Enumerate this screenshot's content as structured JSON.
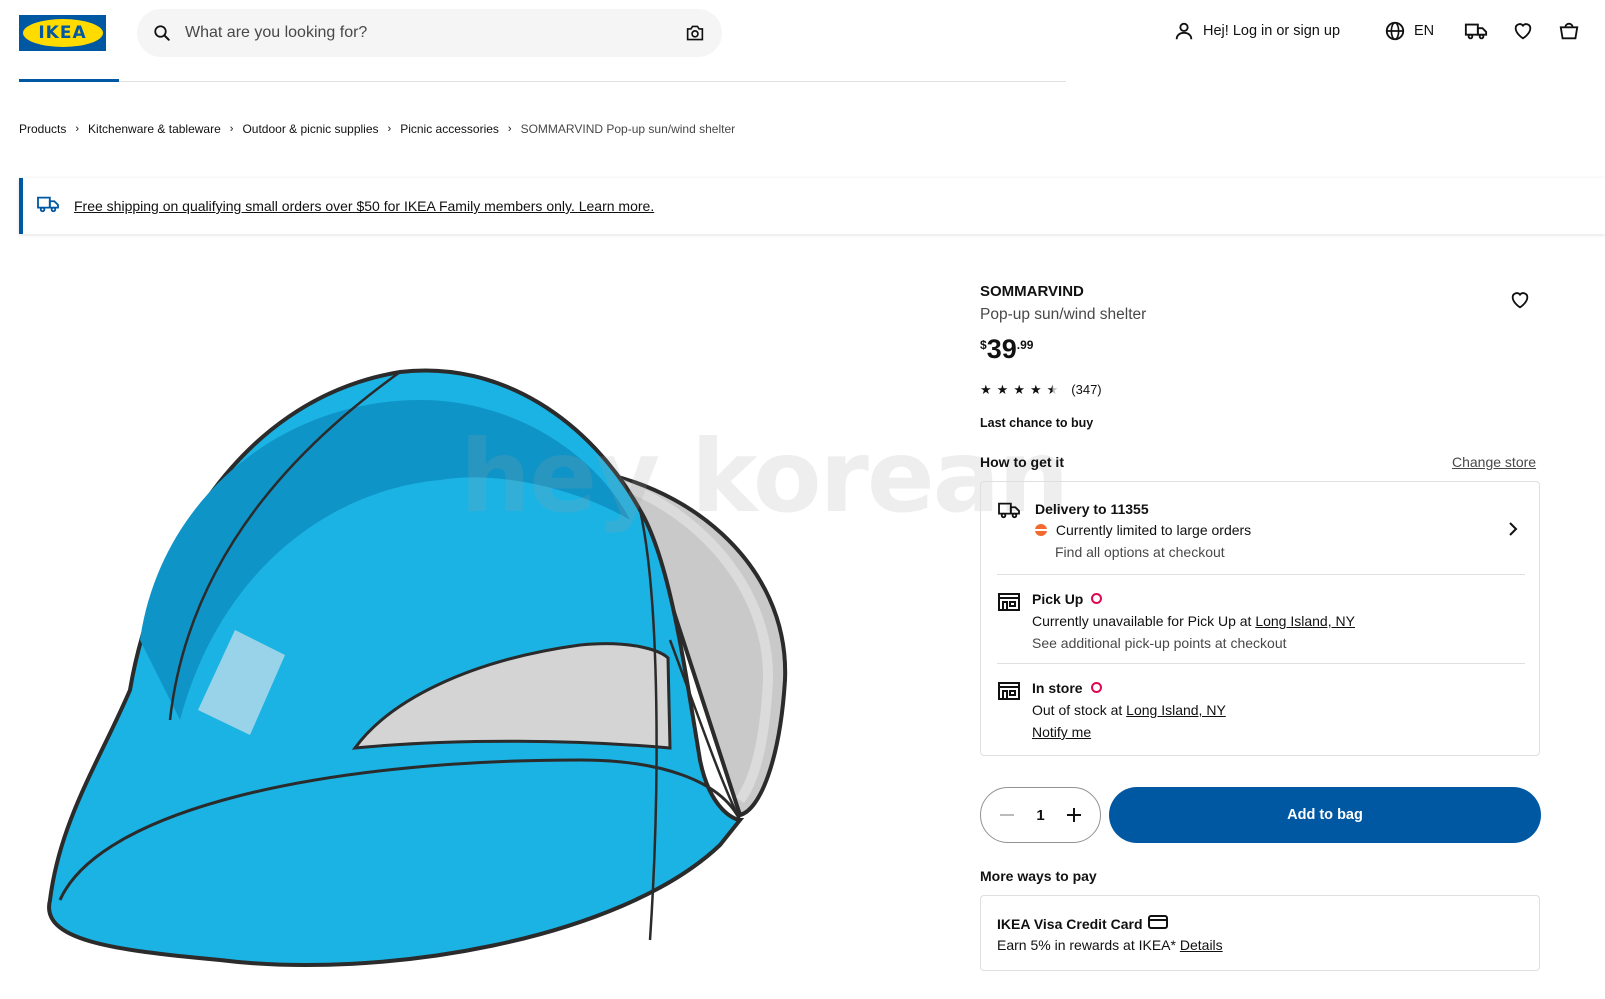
{
  "header": {
    "logo_text": "IKEA",
    "search_placeholder": "What are you looking for?",
    "login_label": "Hej! Log in or sign up",
    "language": "EN"
  },
  "breadcrumb": {
    "items": [
      "Products",
      "Kitchenware & tableware",
      "Outdoor & picnic supplies",
      "Picnic accessories"
    ],
    "current": "SOMMARVIND Pop-up sun/wind shelter"
  },
  "banner": {
    "text": "Free shipping on qualifying small orders over $50 for IKEA Family members only. Learn more."
  },
  "product": {
    "name": "SOMMARVIND",
    "description": "Pop-up sun/wind shelter",
    "price_currency": "$",
    "price_integer": "39",
    "price_decimal": ".99",
    "rating": 4.5,
    "review_count": "(347)",
    "status": "Last chance to buy",
    "watermark": "hey korean"
  },
  "availability": {
    "title": "How to get it",
    "change_store": "Change store",
    "delivery": {
      "title": "Delivery to 11355",
      "line": "Currently limited to large orders",
      "sub": "Find all options at checkout"
    },
    "pickup": {
      "title": "Pick Up",
      "line_prefix": "Currently unavailable for Pick Up at ",
      "store": "Long Island, NY",
      "sub": "See additional pick-up points at checkout"
    },
    "instore": {
      "title": "In store",
      "line_prefix": "Out of stock at ",
      "store": "Long Island, NY",
      "notify": "Notify me"
    }
  },
  "purchase": {
    "quantity": "1",
    "add_to_bag": "Add to bag"
  },
  "payment": {
    "title": "More ways to pay",
    "card_title": "IKEA Visa Credit Card",
    "card_line": "Earn 5% in rewards at IKEA* ",
    "card_link": "Details"
  },
  "colors": {
    "ikea_blue": "#0058a3",
    "ikea_yellow": "#ffdb00",
    "tent_blue": "#1bb3e3",
    "alert_red": "#e00751",
    "alert_orange": "#f26a2e"
  }
}
